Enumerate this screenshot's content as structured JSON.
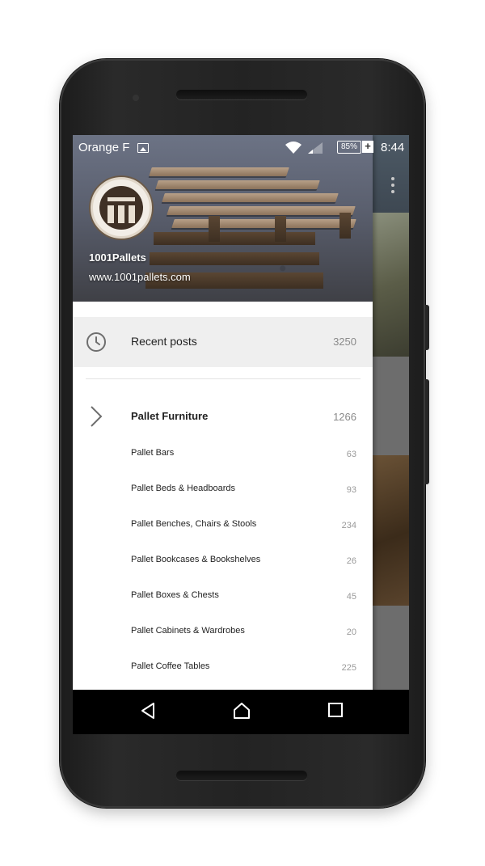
{
  "status_bar": {
    "carrier": "Orange F",
    "battery": "85%",
    "charging": "+",
    "time": "8:44"
  },
  "drawer": {
    "header": {
      "title": "1001Pallets",
      "url": "www.1001pallets.com",
      "logo_icon": "pallet-logo-icon"
    },
    "recent": {
      "icon": "clock-icon",
      "label": "Recent posts",
      "count": "3250"
    },
    "category": {
      "icon": "chevron-right-icon",
      "label": "Pallet Furniture",
      "count": "1266"
    },
    "sub_items": [
      {
        "label": "Pallet Bars",
        "count": "63"
      },
      {
        "label": "Pallet Beds & Headboards",
        "count": "93"
      },
      {
        "label": "Pallet Benches, Chairs & Stools",
        "count": "234"
      },
      {
        "label": "Pallet Bookcases & Bookshelves",
        "count": "26"
      },
      {
        "label": "Pallet Boxes & Chests",
        "count": "45"
      },
      {
        "label": "Pallet Cabinets & Wardrobes",
        "count": "20"
      },
      {
        "label": "Pallet Coffee Tables",
        "count": "225"
      }
    ]
  },
  "nav_bar": {
    "back_icon": "back-triangle-icon",
    "home_icon": "home-icon",
    "recents_icon": "recent-apps-icon"
  },
  "colors": {
    "drawer_bg": "#ffffff",
    "selected_row": "#efefef",
    "nav_bar": "#000000"
  }
}
